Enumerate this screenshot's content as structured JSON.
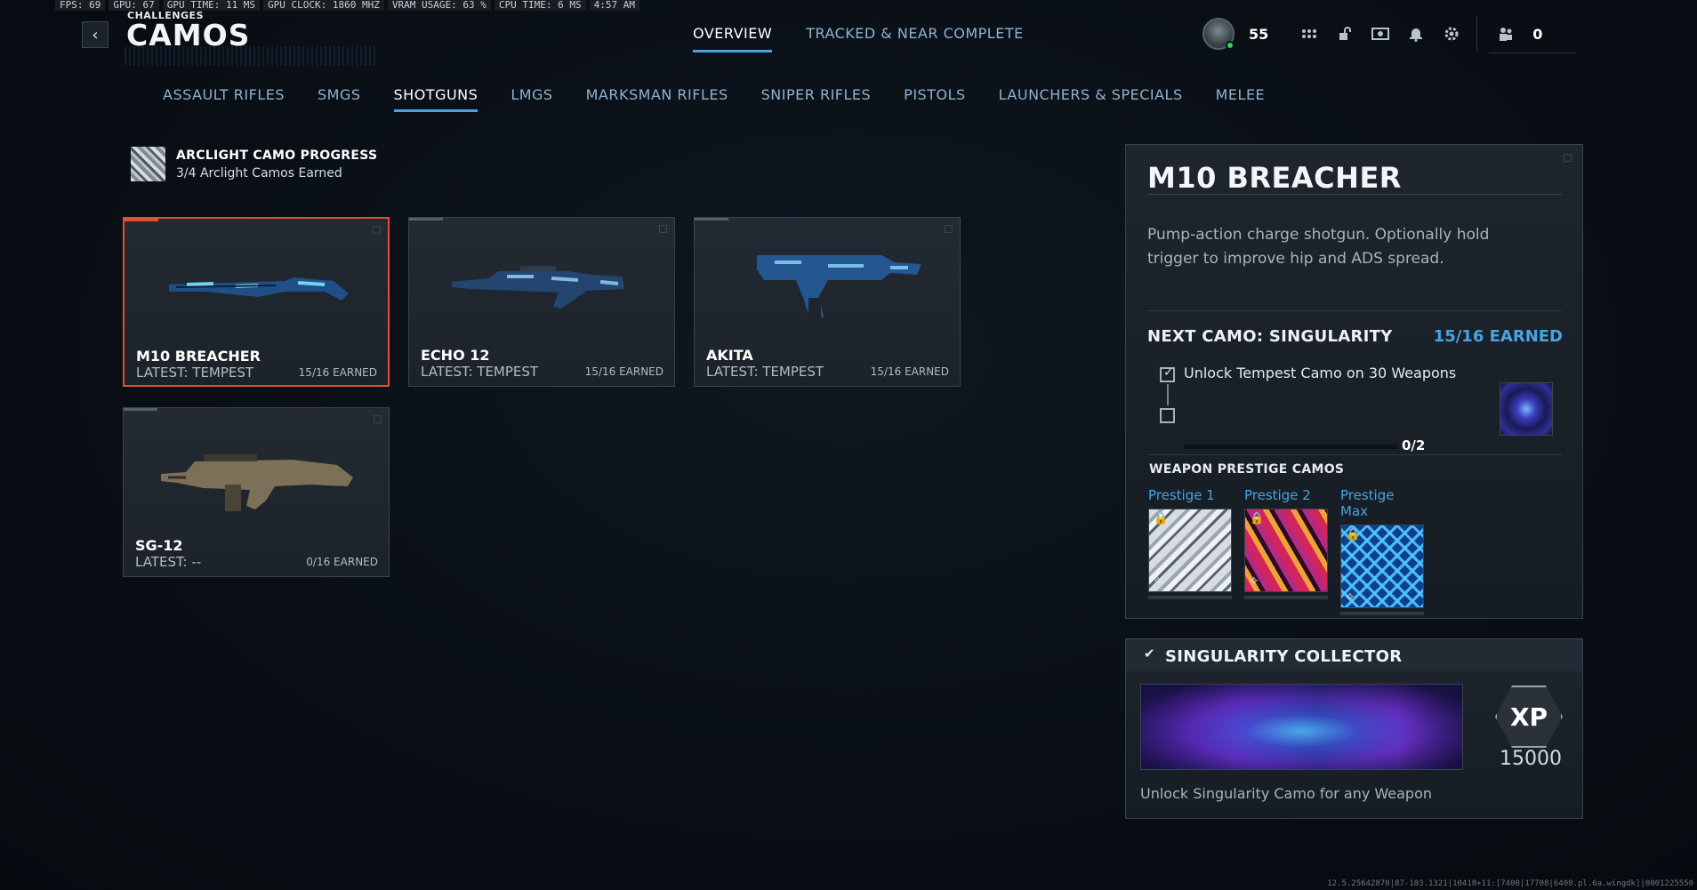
{
  "perf_overlay": [
    "FPS:  69",
    "GPU: 67",
    "GPU TIME: 11 MS",
    "GPU CLOCK: 1860 MHZ",
    "VRAM USAGE: 63 %",
    "CPU TIME:  6 MS",
    "4:57 AM"
  ],
  "header": {
    "kicker": "CHALLENGES",
    "title": "CAMOS",
    "back_icon": "chevron-left-icon",
    "tabs": [
      {
        "label": "OVERVIEW",
        "active": true
      },
      {
        "label": "TRACKED & NEAR COMPLETE",
        "active": false
      }
    ],
    "player_level": "55",
    "icons": [
      "grid-icon",
      "lock-icon",
      "store-icon",
      "bell-icon",
      "gear-icon",
      "friends-icon"
    ],
    "friends_count": "0"
  },
  "categories": [
    {
      "label": "ASSAULT RIFLES",
      "active": false
    },
    {
      "label": "SMGS",
      "active": false
    },
    {
      "label": "SHOTGUNS",
      "active": true
    },
    {
      "label": "LMGS",
      "active": false
    },
    {
      "label": "MARKSMAN RIFLES",
      "active": false
    },
    {
      "label": "SNIPER RIFLES",
      "active": false
    },
    {
      "label": "PISTOLS",
      "active": false
    },
    {
      "label": "LAUNCHERS & SPECIALS",
      "active": false
    },
    {
      "label": "MELEE",
      "active": false
    }
  ],
  "arclight": {
    "title": "ARCLIGHT CAMO PROGRESS",
    "subtitle": "3/4 Arclight Camos Earned"
  },
  "weapons": [
    {
      "name": "M10 BREACHER",
      "latest": "LATEST: TEMPEST",
      "earned": "15/16 EARNED",
      "selected": true,
      "camo": "blue"
    },
    {
      "name": "ECHO 12",
      "latest": "LATEST: TEMPEST",
      "earned": "15/16 EARNED",
      "selected": false,
      "camo": "blue"
    },
    {
      "name": "AKITA",
      "latest": "LATEST: TEMPEST",
      "earned": "15/16 EARNED",
      "selected": false,
      "camo": "blue"
    },
    {
      "name": "SG-12",
      "latest": "LATEST: --",
      "earned": "0/16 EARNED",
      "selected": false,
      "camo": "tan"
    }
  ],
  "detail": {
    "title": "M10 BREACHER",
    "description": "Pump-action charge shotgun. Optionally hold trigger to improve hip and ADS spread.",
    "next_camo": "NEXT CAMO: SINGULARITY",
    "next_earned": "15/16 EARNED",
    "challenge": "Unlock Tempest Camo on 30 Weapons",
    "progress_text": "0/2",
    "progress_fraction": 0,
    "prestige_heading": "WEAPON PRESTIGE CAMOS",
    "prestige": [
      {
        "label": "Prestige 1"
      },
      {
        "label": "Prestige 2"
      },
      {
        "label": "Prestige Max"
      }
    ]
  },
  "collector": {
    "title": "SINGULARITY COLLECTOR",
    "xp_label": "XP",
    "xp_amount": "15000",
    "description": "Unlock Singularity Camo for any Weapon"
  },
  "footer_code": "12.5.25642870|87-103.1321|10418+11:[7400|17708|6408.pl.6a.wingdk]|0001225550",
  "colors": {
    "accent": "#4aa3e0",
    "selected_border": "#e2502d",
    "background": "#0a0f16"
  }
}
